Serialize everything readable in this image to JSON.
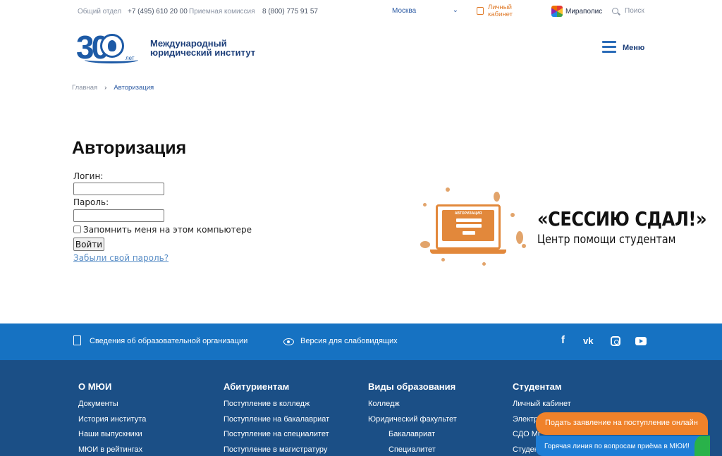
{
  "topbar": {
    "general_label": "Общий отдел",
    "general_phone": "+7 (495) 610 20 00",
    "admission_label": "Приемная комиссия",
    "admission_phone": "8 (800) 775 91 57",
    "city": "Москва",
    "account_line1": "Личный",
    "account_line2": "кабинет",
    "mirapolis": "Мираполис",
    "search": "Поиск"
  },
  "header": {
    "logo_number": "30",
    "logo_years": "лет",
    "institute_line1": "Международный",
    "institute_line2": "юридический институт",
    "menu_label": "Меню"
  },
  "breadcrumb": {
    "home": "Главная",
    "separator": "›",
    "current": "Авторизация"
  },
  "auth": {
    "title": "Авторизация",
    "login_label": "Логин:",
    "login_value": "",
    "password_label": "Пароль:",
    "password_value": "",
    "remember_label": "Запомнить меня на этом компьютере",
    "submit_label": "Войти",
    "forgot_label": "Забыли свой пароль?"
  },
  "promo": {
    "screen_title": "АВТОРИЗАЦИЯ",
    "headline": "«СЕССИЮ СДАЛ!»",
    "subheadline": "Центр помощи студентам",
    "accent_color": "#e2883b"
  },
  "strip": {
    "org_info": "Сведения об образовательной организации",
    "low_vision": "Версия для слабовидящих",
    "social": [
      "facebook-icon",
      "vk-icon",
      "instagram-icon",
      "youtube-icon"
    ],
    "color": "#1672c2"
  },
  "footer": {
    "color": "#1b4f86",
    "columns": [
      {
        "heading": "О МЮИ",
        "links": [
          "Документы",
          "История института",
          "Наши выпускники",
          "МЮИ в рейтингах"
        ]
      },
      {
        "heading": "Абитуриентам",
        "links": [
          "Поступление в колледж",
          "Поступление на бакалавриат",
          "Поступление на специалитет",
          "Поступление в магистратуру"
        ]
      },
      {
        "heading": "Виды образования",
        "links": [
          "Колледж",
          "Юридический факультет",
          "Бакалавриат",
          "Специалитет"
        ]
      },
      {
        "heading": "Студентам",
        "links": [
          "Личный кабинет",
          "Электр",
          "СДО Mi",
          "Студен"
        ]
      }
    ]
  },
  "floating": {
    "apply": "Подать заявление на поступление онлайн",
    "hotline": "Горячая линия по вопросам приёма в МЮИ!",
    "apply_color": "#f0822a"
  }
}
